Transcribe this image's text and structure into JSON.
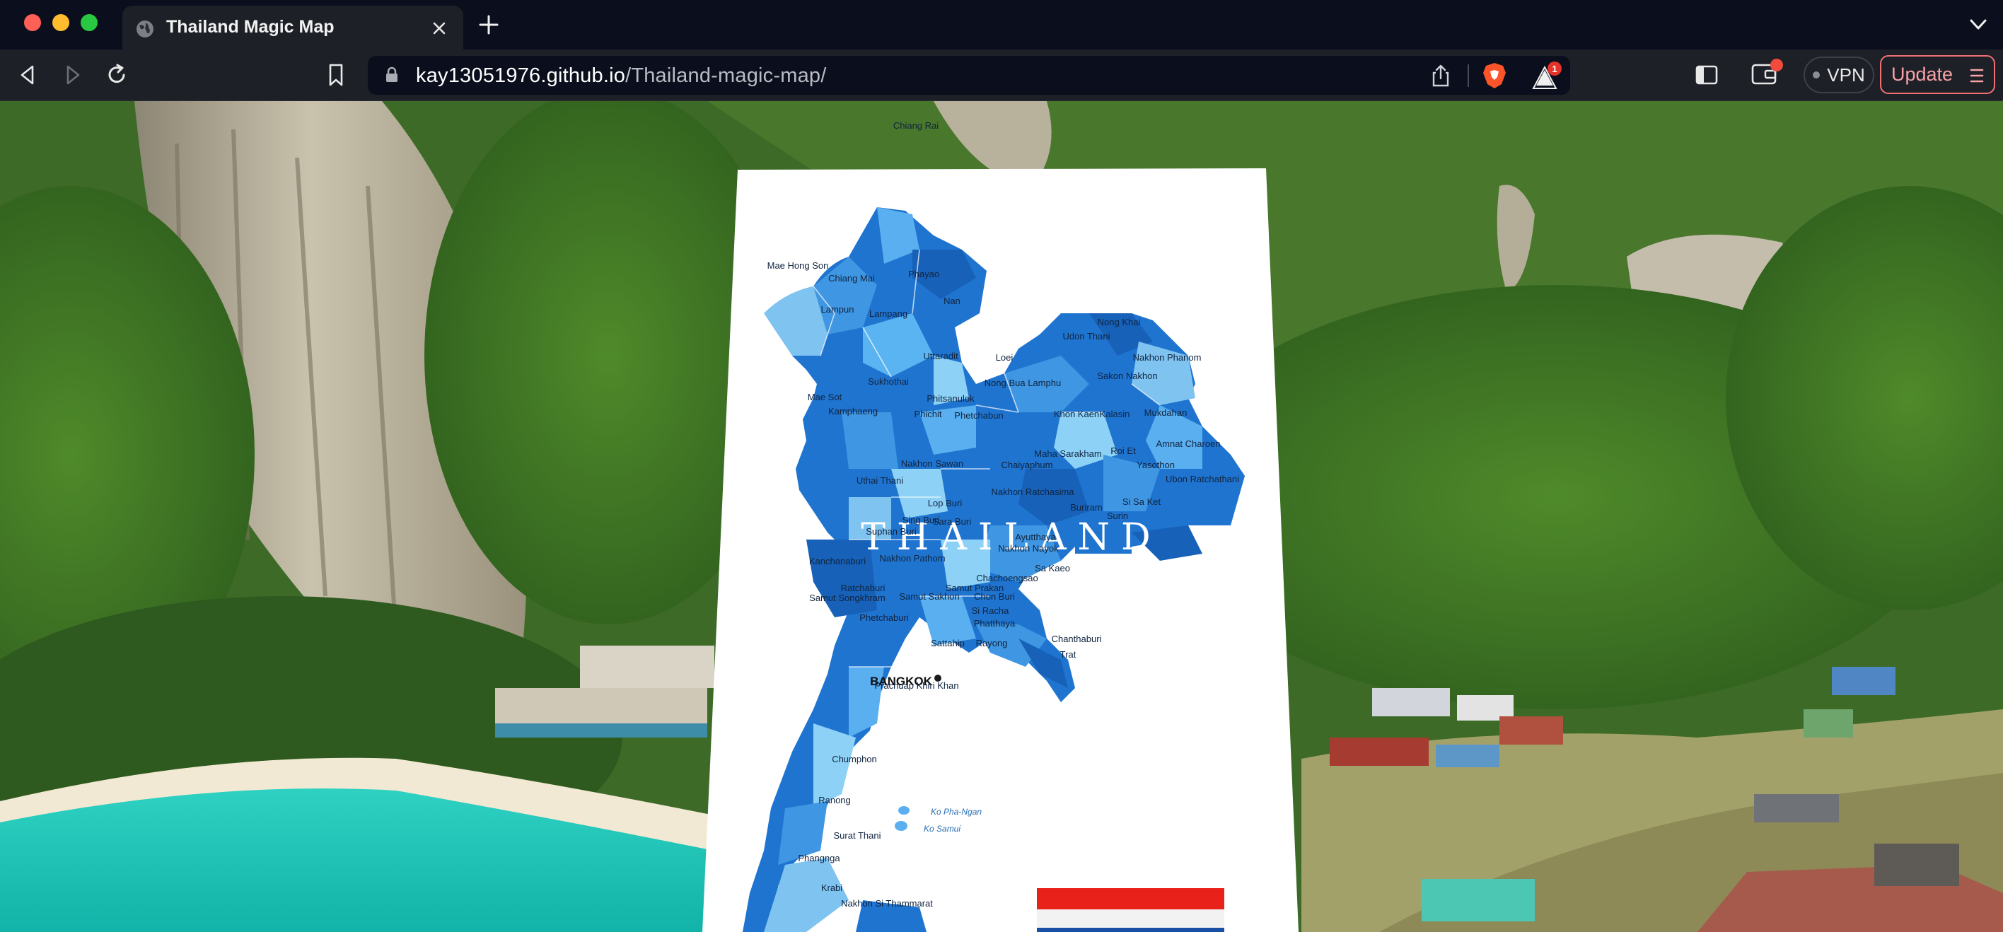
{
  "browser": {
    "tab": {
      "title": "Thailand Magic Map",
      "favicon": "globe-icon"
    },
    "url": {
      "domain": "kay13051976.github.io",
      "path": "/Thailand-magic-map/"
    },
    "rewards_badge": "1",
    "vpn_label": "VPN",
    "update_label": "Update"
  },
  "map": {
    "title": "THAILAND",
    "capital": "BANGKOK",
    "provinces": [
      "Chiang Rai",
      "Mae Hong Son",
      "Chiang Mai",
      "Phayao",
      "Nan",
      "Lampun",
      "Lampang",
      "Uttaradit",
      "Nong Khai",
      "Nakhon Phanom",
      "Loei",
      "Udon Thani",
      "Sakon Nakhon",
      "Sukhothai",
      "Nong Bua Lamphu",
      "Mae Sot",
      "Kamphaeng",
      "Phichit",
      "Phitsanulok",
      "Phetchabun",
      "Khon Kaen",
      "Kalasin",
      "Mukdahan",
      "Amnat Charoen",
      "Nakhon Sawan",
      "Maha Sarakham",
      "Roi Et",
      "Yasothon",
      "Ubon Ratchathani",
      "Uthai Thani",
      "Chaiyaphum",
      "Lop Buri",
      "Nakhon Ratchasima",
      "Buriram",
      "Surin",
      "Si Sa Ket",
      "Sing Buri",
      "Sara Buri",
      "Suphan Buri",
      "Ayutthaya",
      "Nakhon Nayok",
      "Kanchanaburi",
      "Nakhon Pathom",
      "Sa Kaeo",
      "Chachoengsao",
      "Ratchaburi",
      "Samut Songkhram",
      "Samut Sakhon",
      "Samut Prakan",
      "Chon Buri",
      "Phetchaburi",
      "Si Racha",
      "Phatthaya",
      "Sattahip",
      "Rayong",
      "Chanthaburi",
      "Trat",
      "Prachuap Khiri Khan",
      "Chumphon",
      "Ranong",
      "Surat Thani",
      "Phangnga",
      "Krabi",
      "Nakhon Si Thammarat"
    ],
    "islands": [
      "Ko Pha-Ngan",
      "Ko Samui"
    ]
  }
}
